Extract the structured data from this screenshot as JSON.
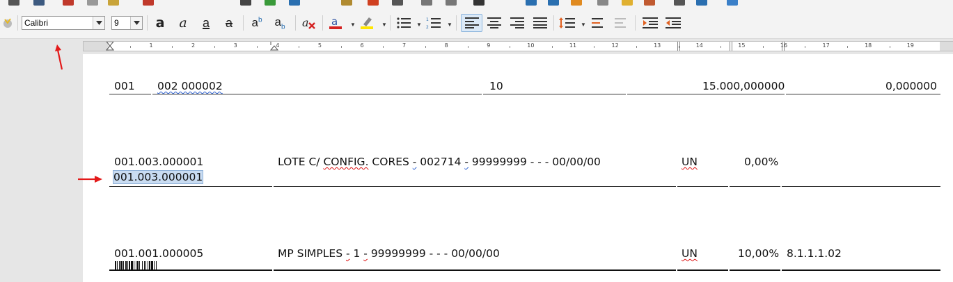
{
  "toolbar": {
    "font_name": "Calibri",
    "font_size": "9",
    "buttons": [
      {
        "name": "bold-icon",
        "glyph": "a"
      },
      {
        "name": "italic-icon",
        "glyph": "a"
      },
      {
        "name": "underline-icon",
        "glyph": "a"
      },
      {
        "name": "strikethrough-icon",
        "glyph": "a"
      },
      {
        "name": "superscript-icon",
        "glyph": "ab"
      },
      {
        "name": "subscript-icon",
        "glyph": "ab"
      }
    ],
    "colors": {
      "font_color": "#d42020",
      "highlight": "#ffe600",
      "active_bg": "#dbe9f7"
    }
  },
  "ruler": {
    "numbers": [
      "1",
      "2",
      "3",
      "4",
      "5",
      "6",
      "7",
      "8",
      "9",
      "10",
      "11",
      "12",
      "13",
      "14",
      "15",
      "16",
      "17",
      "18",
      "19"
    ]
  },
  "document": {
    "row1": {
      "c1": "001",
      "c2": "002 000002",
      "c3": "10",
      "c4": "15.000,000000",
      "c5": "0,000000"
    },
    "row2": {
      "code": "001.003.000001",
      "code_selected": "001.003.000001",
      "desc_a": "LOTE C/ ",
      "desc_b": "CONFIG.",
      "desc_c": " CORES ",
      "desc_d": "-",
      "desc_e": " 002714 ",
      "desc_f": "-",
      "desc_g": " 99999999 -  -  - 00/00/00",
      "unit": "UN",
      "pct": "0,00%"
    },
    "row3": {
      "code": "001.001.000005",
      "desc_a": "MP SIMPLES ",
      "desc_b": "-",
      "desc_c": " 1 ",
      "desc_d": "-",
      "desc_e": " 99999999 -  -  - 00/00/00",
      "unit": "UN",
      "pct": "10,00%",
      "account": "8.1.1.1.02"
    }
  }
}
